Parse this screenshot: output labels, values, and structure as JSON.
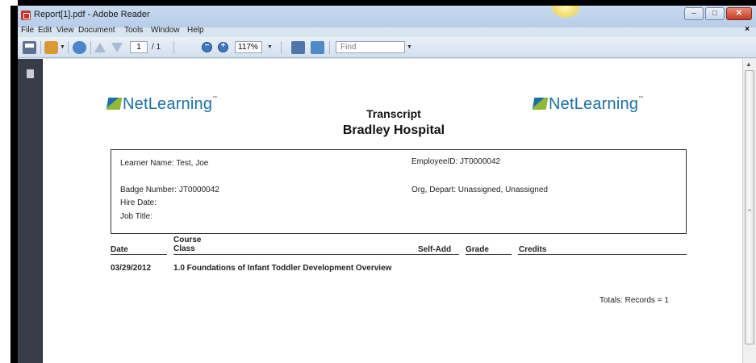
{
  "window": {
    "title": "Report[1].pdf - Adobe Reader",
    "controls": {
      "minimize": "–",
      "maximize": "□",
      "close": "✕"
    }
  },
  "menu": {
    "items": [
      "File",
      "Edit",
      "View",
      "Document",
      "Tools",
      "Window",
      "Help"
    ],
    "close_doc": "×"
  },
  "toolbar": {
    "page_current": "1",
    "page_total": "/ 1",
    "zoom": "117%",
    "find_placeholder": "Find",
    "icons": [
      "print-icon",
      "share-icon",
      "collaborate-icon",
      "previous-page-icon",
      "next-page-icon",
      "zoom-out-icon",
      "zoom-in-icon",
      "fit-width-icon",
      "fit-page-icon"
    ]
  },
  "document": {
    "logo_text": "NetLearning",
    "title": "Transcript",
    "subtitle": "Bradley Hospital",
    "learner": {
      "name_label": "Learner Name: Test, Joe",
      "employee_label": "EmployeeID: JT0000042",
      "badge_label": "Badge Number: JT0000042",
      "org_label": "Org, Depart: Unassigned, Unassigned",
      "hire_label": "Hire Date:",
      "job_label": "Job Title:"
    },
    "columns": {
      "date": "Date",
      "course": "Course",
      "class": "Class",
      "self_add": "Self-Add",
      "grade": "Grade",
      "credits": "Credits"
    },
    "rows": [
      {
        "date": "03/29/2012",
        "course": "1.0 Foundations of Infant Toddler Development Overview"
      }
    ],
    "totals": "Totals: Records = 1"
  }
}
